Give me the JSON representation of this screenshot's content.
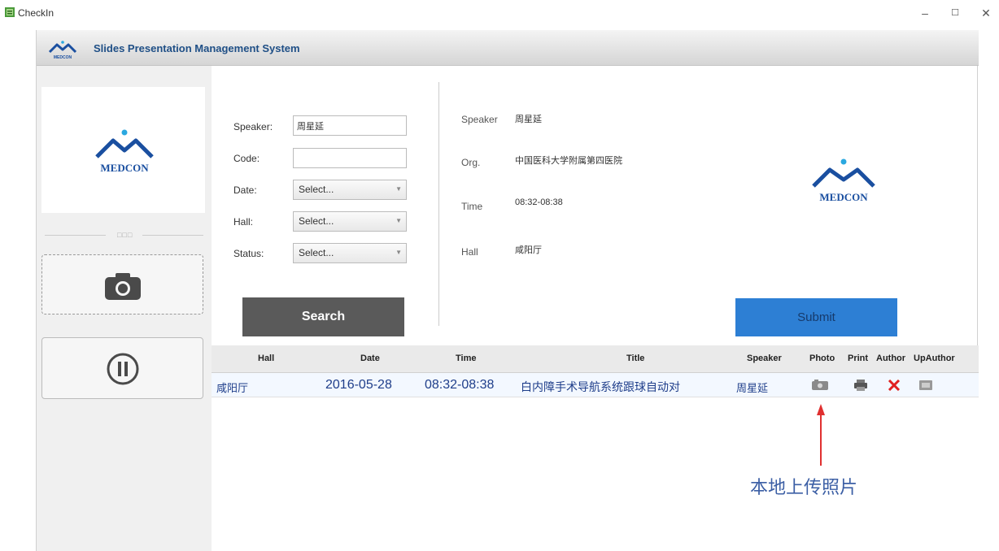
{
  "window": {
    "title": "CheckIn",
    "minimize_label": "–",
    "maximize_label": "☐",
    "close_label": "✕"
  },
  "header": {
    "title": "Slides Presentation Management System",
    "logo_text": "MEDCON"
  },
  "left": {
    "logo_text": "MEDCON",
    "divider_dots": "□□□",
    "camera_icon": "camera-icon",
    "pause_icon": "pause-icon"
  },
  "search_form": {
    "speaker_label": "Speaker:",
    "speaker_value": "周星延",
    "code_label": "Code:",
    "code_value": "",
    "date_label": "Date:",
    "date_value": "Select...",
    "hall_label": "Hall:",
    "hall_value": "Select...",
    "status_label": "Status:",
    "status_value": "Select...",
    "search_label": "Search"
  },
  "detail": {
    "speaker_label": "Speaker",
    "speaker_value": "周星延",
    "org_label": "Org.",
    "org_value": "中国医科大学附属第四医院",
    "time_label": "Time",
    "time_value": "08:32-08:38",
    "hall_label": "Hall",
    "hall_value": "咸阳厅"
  },
  "photo": {
    "logo_text": "MEDCON",
    "submit_label": "Submit"
  },
  "table": {
    "columns": [
      "Hall",
      "Date",
      "Time",
      "Title",
      "Speaker",
      "Photo",
      "Print",
      "Author",
      "UpAuthor"
    ],
    "rows": [
      {
        "hall": "咸阳厅",
        "date": "2016-05-28",
        "time": "08:32-08:38",
        "title": "白内障手术导航系统跟球自动对",
        "speaker": "周星延",
        "photo_icon": "photo-upload-icon",
        "print_icon": "printer-icon",
        "author_icon": "delete-x-icon",
        "upauthor_icon": "upload-author-icon"
      }
    ]
  },
  "annotation": {
    "text": "本地上传照片"
  },
  "colors": {
    "search_button": "#5a5a5a",
    "submit_button": "#2d7fd4",
    "header_title": "#1f4f86",
    "logo_blue": "#1a4fa0",
    "logo_dot": "#2aa8e0",
    "delete_red": "#e02020",
    "annotation_red": "#e03030"
  }
}
